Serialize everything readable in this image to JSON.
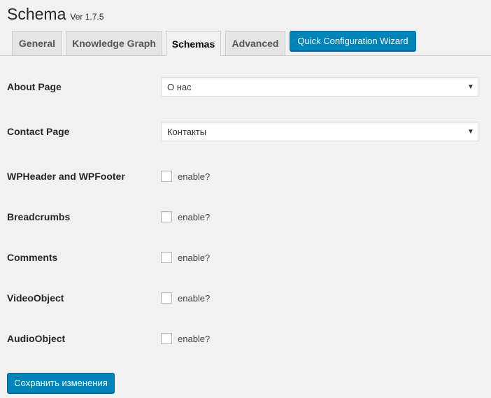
{
  "header": {
    "title": "Schema",
    "version": "Ver 1.7.5"
  },
  "tabs": [
    {
      "label": "General",
      "active": false
    },
    {
      "label": "Knowledge Graph",
      "active": false
    },
    {
      "label": "Schemas",
      "active": true
    },
    {
      "label": "Advanced",
      "active": false
    }
  ],
  "wizard_button": {
    "label": "Quick Configuration Wizard"
  },
  "fields": {
    "about_page": {
      "label": "About Page",
      "value": "О нас"
    },
    "contact_page": {
      "label": "Contact Page",
      "value": "Контакты"
    }
  },
  "toggles": [
    {
      "label": "WPHeader and WPFooter",
      "checkbox_text": "enable?",
      "checked": false
    },
    {
      "label": "Breadcrumbs",
      "checkbox_text": "enable?",
      "checked": false
    },
    {
      "label": "Comments",
      "checkbox_text": "enable?",
      "checked": false
    },
    {
      "label": "VideoObject",
      "checkbox_text": "enable?",
      "checked": false
    },
    {
      "label": "AudioObject",
      "checkbox_text": "enable?",
      "checked": false
    }
  ],
  "save_button": {
    "label": "Сохранить изменения"
  },
  "colors": {
    "primary_button": "#0085ba",
    "background": "#f1f1f1",
    "tab_inactive": "#e5e5e5"
  },
  "icons": {
    "select_arrow": "dropdown-arrow-icon"
  }
}
